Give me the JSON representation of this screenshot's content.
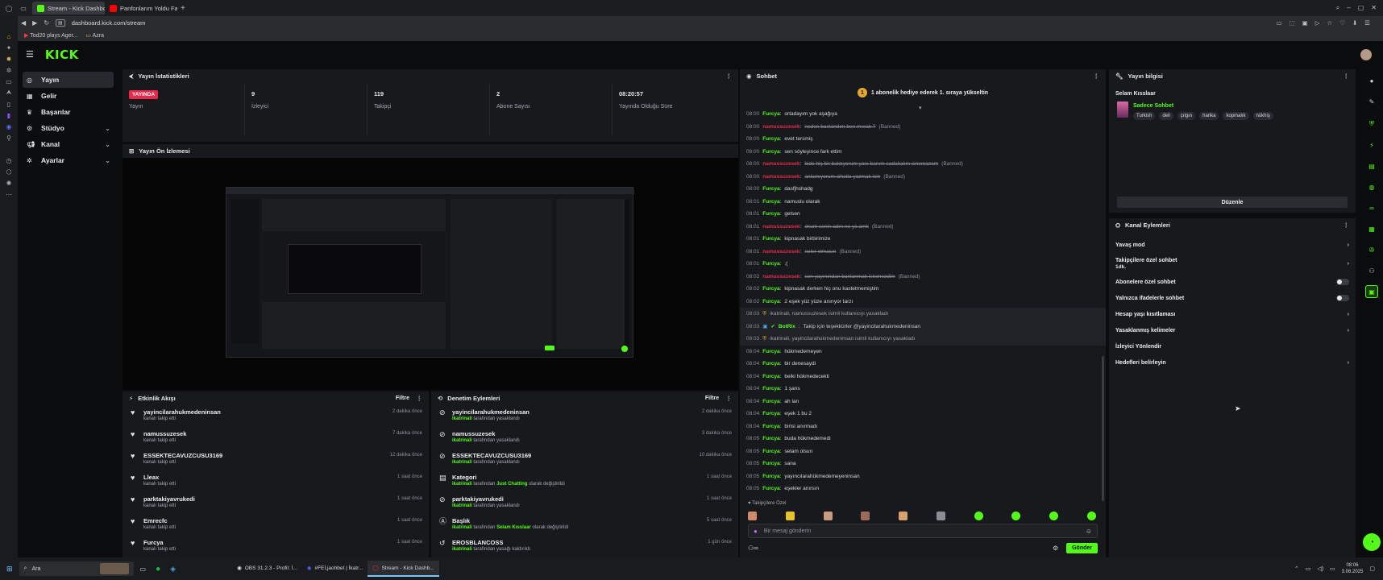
{
  "browser": {
    "tabs": [
      {
        "label": "Stream - Kick Dashboard",
        "active": true
      },
      {
        "label": "Panfonlarım Yoldu Fatih",
        "active": false
      }
    ],
    "url": "dashboard.kick.com/stream",
    "bookmarks": [
      "Tod20 plays Ager...",
      "Azra"
    ]
  },
  "kick": {
    "logo": "KICK",
    "nav": [
      {
        "label": "Yayın",
        "icon": "broadcast-icon",
        "active": true,
        "chevron": false
      },
      {
        "label": "Gelir",
        "icon": "wallet-icon",
        "active": false,
        "chevron": false
      },
      {
        "label": "Başarılar",
        "icon": "trophy-icon",
        "active": false,
        "chevron": false
      },
      {
        "label": "Stüdyo",
        "icon": "gear-icon",
        "active": false,
        "chevron": true
      },
      {
        "label": "Kanal",
        "icon": "megaphone-icon",
        "active": false,
        "chevron": true
      },
      {
        "label": "Ayarlar",
        "icon": "cog-icon",
        "active": false,
        "chevron": true
      }
    ]
  },
  "stats": {
    "title": "Yayın İstatistikleri",
    "items": [
      {
        "value": "YAYINDA",
        "label": "Yayın",
        "badge": true
      },
      {
        "value": "9",
        "label": "İzleyici"
      },
      {
        "value": "119",
        "label": "Takipçi"
      },
      {
        "value": "2",
        "label": "Abone Sayısı"
      },
      {
        "value": "08:20:57",
        "label": "Yayında Olduğu Süre"
      }
    ]
  },
  "preview": {
    "title": "Yayın Ön İzlemesi"
  },
  "activity": {
    "title": "Etkinlik Akışı",
    "filter": "Filtre",
    "items": [
      {
        "name": "yayincilarahukmedeninsan",
        "sub": "kanalı takip etti",
        "time": "2 dakika önce"
      },
      {
        "name": "namussuzesek",
        "sub": "kanalı takip etti",
        "time": "7 dakika önce"
      },
      {
        "name": "ESSEKTECAVUZCUSU3169",
        "sub": "kanalı takip etti",
        "time": "12 dakika önce"
      },
      {
        "name": "Lleax",
        "sub": "kanalı takip etti",
        "time": "1 saat önce"
      },
      {
        "name": "parktakiyavrukedi",
        "sub": "kanalı takip etti",
        "time": "1 saat önce"
      },
      {
        "name": "Emrecfc",
        "sub": "kanalı takip etti",
        "time": "1 saat önce"
      },
      {
        "name": "Furcya",
        "sub": "kanalı takip etti",
        "time": "1 saat önce"
      }
    ]
  },
  "moderation": {
    "title": "Denetim Eylemleri",
    "filter": "Filtre",
    "items": [
      {
        "icon": "ban-icon",
        "name": "yayincilarahukmedeninsan",
        "actor": "ikatrinali",
        "pre": "",
        "mid": "",
        "post": "tarafından yasaklandı",
        "time": "2 dakika önce"
      },
      {
        "icon": "ban-icon",
        "name": "namussuzesek",
        "actor": "ikatrinali",
        "pre": "",
        "mid": "",
        "post": "tarafından yasaklandı",
        "time": "3 dakika önce"
      },
      {
        "icon": "ban-icon",
        "name": "ESSEKTECAVUZCUSU3169",
        "actor": "ikatrinali",
        "pre": "",
        "mid": "",
        "post": "tarafından yasaklandı",
        "time": "10 dakika önce"
      },
      {
        "icon": "category-icon",
        "name": "Kategori",
        "actor": "ikatrinali",
        "pre": "tarafından",
        "mid": "Just Chatting",
        "post": "olarak değiştirildi",
        "time": "1 saat önce"
      },
      {
        "icon": "ban-icon",
        "name": "parktakiyavrukedi",
        "actor": "ikatrinali",
        "pre": "",
        "mid": "",
        "post": "tarafından yasaklandı",
        "time": "1 saat önce"
      },
      {
        "icon": "title-icon",
        "name": "Başlık",
        "actor": "ikatrinali",
        "pre": "tarafından",
        "mid": "Selam Kısslaar",
        "post": "olarak değiştirildi",
        "time": "5 saat önce"
      },
      {
        "icon": "unban-icon",
        "name": "EROSBLANCOSS",
        "actor": "ikatrinali",
        "pre": "",
        "mid": "",
        "post": "tarafından yasağı kaldırıldı",
        "time": "1 gün önce"
      }
    ]
  },
  "chat": {
    "title": "Sohbet",
    "pinned": "1 abonelik hediye ederek 1. sıraya yükseltin",
    "pinned_num": "1",
    "messages": [
      {
        "t": "08:00",
        "u": "Furcya",
        "m": "ortadayım yok aşağıya",
        "kind": "normal"
      },
      {
        "t": "08:00",
        "u": "namussuzesek",
        "m": "neden banlandım ben merak ?",
        "kind": "deleted",
        "tag": "(Banned)"
      },
      {
        "t": "08:00",
        "u": "Furcya",
        "m": "evet tersmiş",
        "kind": "normal"
      },
      {
        "t": "08:00",
        "u": "Furcya",
        "m": "sen söyleyince fark ettim",
        "kind": "normal"
      },
      {
        "t": "08:00",
        "u": "namussuzesek",
        "m": "bide hiç bir baktıyorum yanı banım sadakalım cinemazam",
        "kind": "deleted",
        "tag": "(Banned)"
      },
      {
        "t": "08:00",
        "u": "namussuzesek",
        "m": "anlamıyorum cihatla yazmak icin",
        "kind": "deleted",
        "tag": "(Banned)"
      },
      {
        "t": "08:00",
        "u": "Furcya",
        "m": "dasfjhshadg",
        "kind": "normal"
      },
      {
        "t": "08:01",
        "u": "Furcya",
        "m": "namuslu olarak",
        "kind": "normal"
      },
      {
        "t": "08:01",
        "u": "Furcya",
        "m": "gelsen",
        "kind": "normal"
      },
      {
        "t": "08:01",
        "u": "namussuzesek",
        "m": "okum senin adın ne ya amk",
        "kind": "deleted",
        "tag": "(Banned)"
      },
      {
        "t": "08:01",
        "u": "Furcya",
        "m": "kipnasak birbirimize",
        "kind": "normal"
      },
      {
        "t": "08:01",
        "u": "namussuzesek",
        "m": "neler olmasın",
        "kind": "deleted",
        "tag": "(Banned)"
      },
      {
        "t": "08:01",
        "u": "Furcya",
        "m": ":(",
        "kind": "normal"
      },
      {
        "t": "08:02",
        "u": "namussuzesek",
        "m": "sen yayınından banlanmak istemezdim",
        "kind": "deleted",
        "tag": "(Banned)"
      },
      {
        "t": "08:02",
        "u": "Furcya",
        "m": "kipnasak derken hiç onu kastetmemiştim",
        "kind": "normal"
      },
      {
        "t": "08:02",
        "u": "Furcya",
        "m": "2 eşek yüz yüze anırıyor tarzı",
        "kind": "normal"
      },
      {
        "t": "08:03",
        "u": "",
        "m": "ikatrinali, namussuzesek isimli kullanıcıyı yasakladı",
        "kind": "system"
      },
      {
        "t": "08:03",
        "u": "BotRix",
        "m": "Takip için teşekkürler @yayincilarahukmedeninsan",
        "kind": "bot"
      },
      {
        "t": "08:03",
        "u": "",
        "m": "ikatrinali, yayincilarahukmedeninsan isimli kullanıcıyı yasakladı",
        "kind": "system"
      },
      {
        "t": "08:04",
        "u": "Furcya",
        "m": "hükmedemeyen",
        "kind": "normal"
      },
      {
        "t": "08:04",
        "u": "Furcya",
        "m": "bir denesaydi",
        "kind": "normal"
      },
      {
        "t": "08:04",
        "u": "Furcya",
        "m": "belki hükmedecekti",
        "kind": "normal"
      },
      {
        "t": "08:04",
        "u": "Furcya",
        "m": "1 şans",
        "kind": "normal"
      },
      {
        "t": "08:04",
        "u": "Furcya",
        "m": "ah lan",
        "kind": "normal"
      },
      {
        "t": "08:04",
        "u": "Furcya",
        "m": "eşek 1 bu 2",
        "kind": "normal"
      },
      {
        "t": "08:04",
        "u": "Furcya",
        "m": "birisi anırmadı",
        "kind": "normal"
      },
      {
        "t": "08:05",
        "u": "Furcya",
        "m": "buda hükmedemedi",
        "kind": "normal"
      },
      {
        "t": "08:05",
        "u": "Furcya",
        "m": "selam olsun",
        "kind": "normal"
      },
      {
        "t": "08:05",
        "u": "Furcya",
        "m": "sana",
        "kind": "normal"
      },
      {
        "t": "08:05",
        "u": "Furcya",
        "m": "yayıncılarahükmedemeyeninsan",
        "kind": "normal"
      },
      {
        "t": "08:05",
        "u": "Furcya",
        "m": "eşekler anırsın",
        "kind": "normal"
      }
    ],
    "followers_only": "Takipçilere Özel",
    "input_placeholder": "Bir mesaj gönderin",
    "send": "Gönder"
  },
  "stream_info": {
    "title": "Yayın bilgisi",
    "stream_title": "Selam Kısslaar",
    "category": "Sadece Sohbet",
    "tags": [
      "Turkish",
      "deli",
      "çılgın",
      "harika",
      "kopmalık",
      "nükhiş"
    ],
    "edit": "Düzenle"
  },
  "channel_actions": {
    "title": "Kanal Eylemleri",
    "items": [
      {
        "label": "Yavaş mod",
        "sub": "",
        "ctrl": "arrow"
      },
      {
        "label": "Takipçilere özel sohbet",
        "sub": "1dk.",
        "ctrl": "arrow"
      },
      {
        "label": "Abonelere özel sohbet",
        "sub": "",
        "ctrl": "toggle"
      },
      {
        "label": "Yalnızca ifadelerle sohbet",
        "sub": "",
        "ctrl": "toggle"
      },
      {
        "label": "Hesap yaşı kısıtlaması",
        "sub": "",
        "ctrl": "arrow"
      },
      {
        "label": "Yasaklanmış kelimeler",
        "sub": "",
        "ctrl": "arrow"
      },
      {
        "label": "İzleyici Yönlendir",
        "sub": "",
        "ctrl": "none"
      },
      {
        "label": "Hedefleri belirleyin",
        "sub": "",
        "ctrl": "arrow"
      }
    ]
  },
  "taskbar": {
    "search": "Ara",
    "apps": [
      "OBS 31.2.3 - Profil: İ...",
      "#FEİ,jaohbet | İkatr...",
      "Stream - Kick Dashb..."
    ],
    "time": "08:06",
    "date": "3.06.2025"
  },
  "colors": {
    "kick_green": "#53fc18",
    "live_red": "#e8294b",
    "panel_bg": "#18191d",
    "page_bg": "#0b0c0e"
  }
}
